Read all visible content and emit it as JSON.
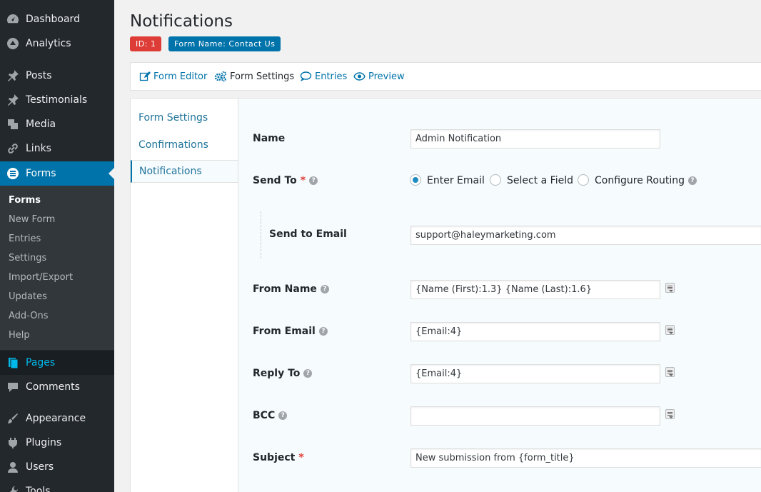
{
  "sidebar": {
    "items": [
      {
        "label": "Dashboard",
        "icon": "dashboard-icon"
      },
      {
        "label": "Analytics",
        "icon": "analytics-icon"
      },
      {
        "label": "Posts",
        "icon": "pushpin-icon"
      },
      {
        "label": "Testimonials",
        "icon": "pushpin-icon"
      },
      {
        "label": "Media",
        "icon": "media-icon"
      },
      {
        "label": "Links",
        "icon": "link-icon"
      },
      {
        "label": "Forms",
        "icon": "forms-icon"
      },
      {
        "label": "Pages",
        "icon": "pages-icon"
      },
      {
        "label": "Comments",
        "icon": "comment-icon"
      },
      {
        "label": "Appearance",
        "icon": "brush-icon"
      },
      {
        "label": "Plugins",
        "icon": "plugin-icon"
      },
      {
        "label": "Users",
        "icon": "user-icon"
      },
      {
        "label": "Tools",
        "icon": "wrench-icon"
      }
    ],
    "submenu": [
      "Forms",
      "New Form",
      "Entries",
      "Settings",
      "Import/Export",
      "Updates",
      "Add-Ons",
      "Help"
    ]
  },
  "header": {
    "title": "Notifications",
    "id_badge": "ID: 1",
    "form_badge": "Form Name: Contact Us"
  },
  "toolbar": {
    "form_editor": "Form Editor",
    "form_settings": "Form Settings",
    "entries": "Entries",
    "preview": "Preview"
  },
  "settings_nav": [
    "Form Settings",
    "Confirmations",
    "Notifications"
  ],
  "form": {
    "name_label": "Name",
    "name_value": "Admin Notification",
    "send_to_label": "Send To",
    "send_to_options": [
      "Enter Email",
      "Select a Field",
      "Configure Routing"
    ],
    "send_to_selected": "Enter Email",
    "send_to_email_label": "Send to Email",
    "send_to_email_value": "support@haleymarketing.com",
    "from_name_label": "From Name",
    "from_name_value": "{Name (First):1.3} {Name (Last):1.6}",
    "from_email_label": "From Email",
    "from_email_value": "{Email:4}",
    "reply_to_label": "Reply To",
    "reply_to_value": "{Email:4}",
    "bcc_label": "BCC",
    "bcc_value": "",
    "subject_label": "Subject",
    "subject_value": "New submission from {form_title}",
    "required_mark": "*"
  },
  "colors": {
    "sidebar_bg": "#23282d",
    "accent": "#0073aa",
    "id_badge": "#dd3d36",
    "link": "#0073aa"
  }
}
